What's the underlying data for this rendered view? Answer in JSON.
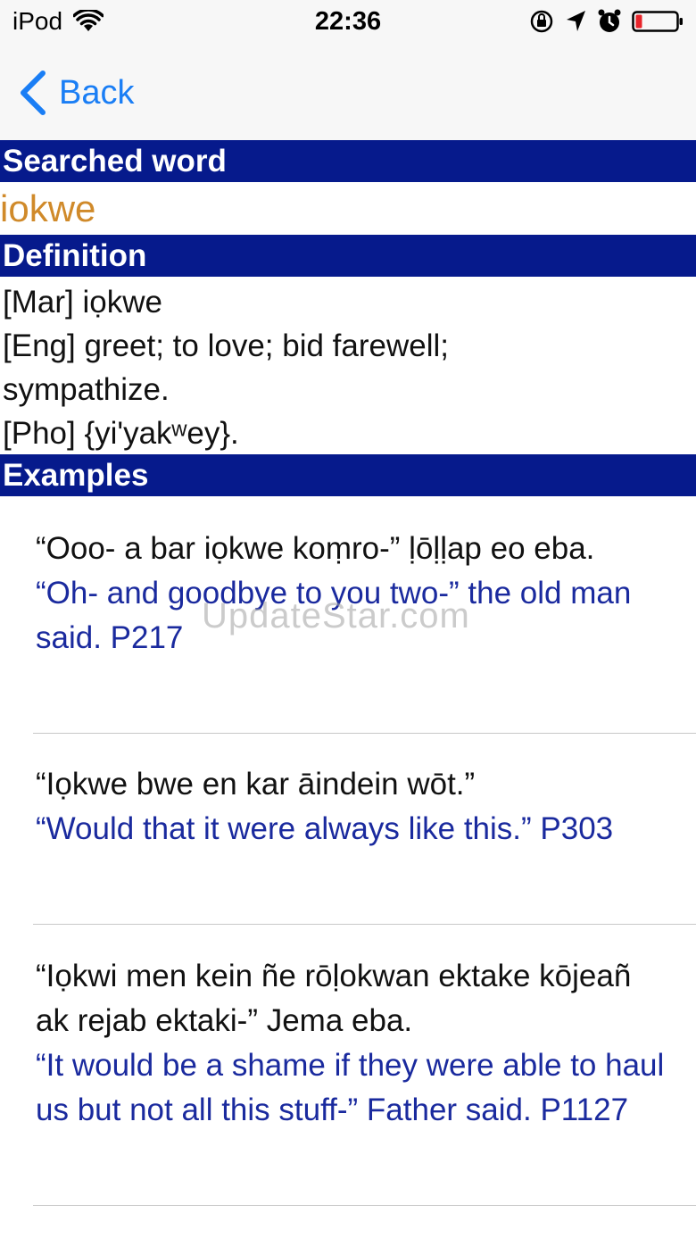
{
  "status_bar": {
    "carrier": "iPod",
    "time": "22:36"
  },
  "nav": {
    "back_label": "Back"
  },
  "sections": {
    "searched_word_header": "Searched word",
    "definition_header": "Definition",
    "examples_header": "Examples"
  },
  "searched_word": "iokwe",
  "definition": {
    "mar": "[Mar] iọkwe",
    "eng_line1": "[Eng] greet;  to love;  bid farewell;",
    "eng_line2": "sympathize.",
    "pho": "[Pho] {yi'yakʷey}."
  },
  "examples": [
    {
      "mar": "“Ooo- a bar iọkwe koṃro-” ḷōḷḷap eo eba.",
      "eng": "“Oh- and goodbye to you two-” the old man said. P217"
    },
    {
      "mar": "“Iọkwe bwe en kar āindein wōt.”",
      "eng": "“Would that it were always like this.” P303"
    },
    {
      "mar": "“Iọkwi men kein ñe rōḷokwan ektake kōjeañ ak rejab ektaki-” Jema eba.",
      "eng": "“It would be a shame if they were able to haul us but not all this stuff-” Father said. P1127"
    }
  ],
  "watermark": "UpdateStar.com",
  "colors": {
    "header_bg": "#061a8c",
    "searched_word": "#d08a2a",
    "english_text": "#1a2a9e",
    "ios_blue": "#1a7ef5"
  },
  "icons": {
    "status": [
      "wifi-icon",
      "orientation-lock-icon",
      "location-arrow-icon",
      "alarm-icon",
      "battery-icon"
    ],
    "nav": [
      "chevron-left-icon"
    ]
  }
}
